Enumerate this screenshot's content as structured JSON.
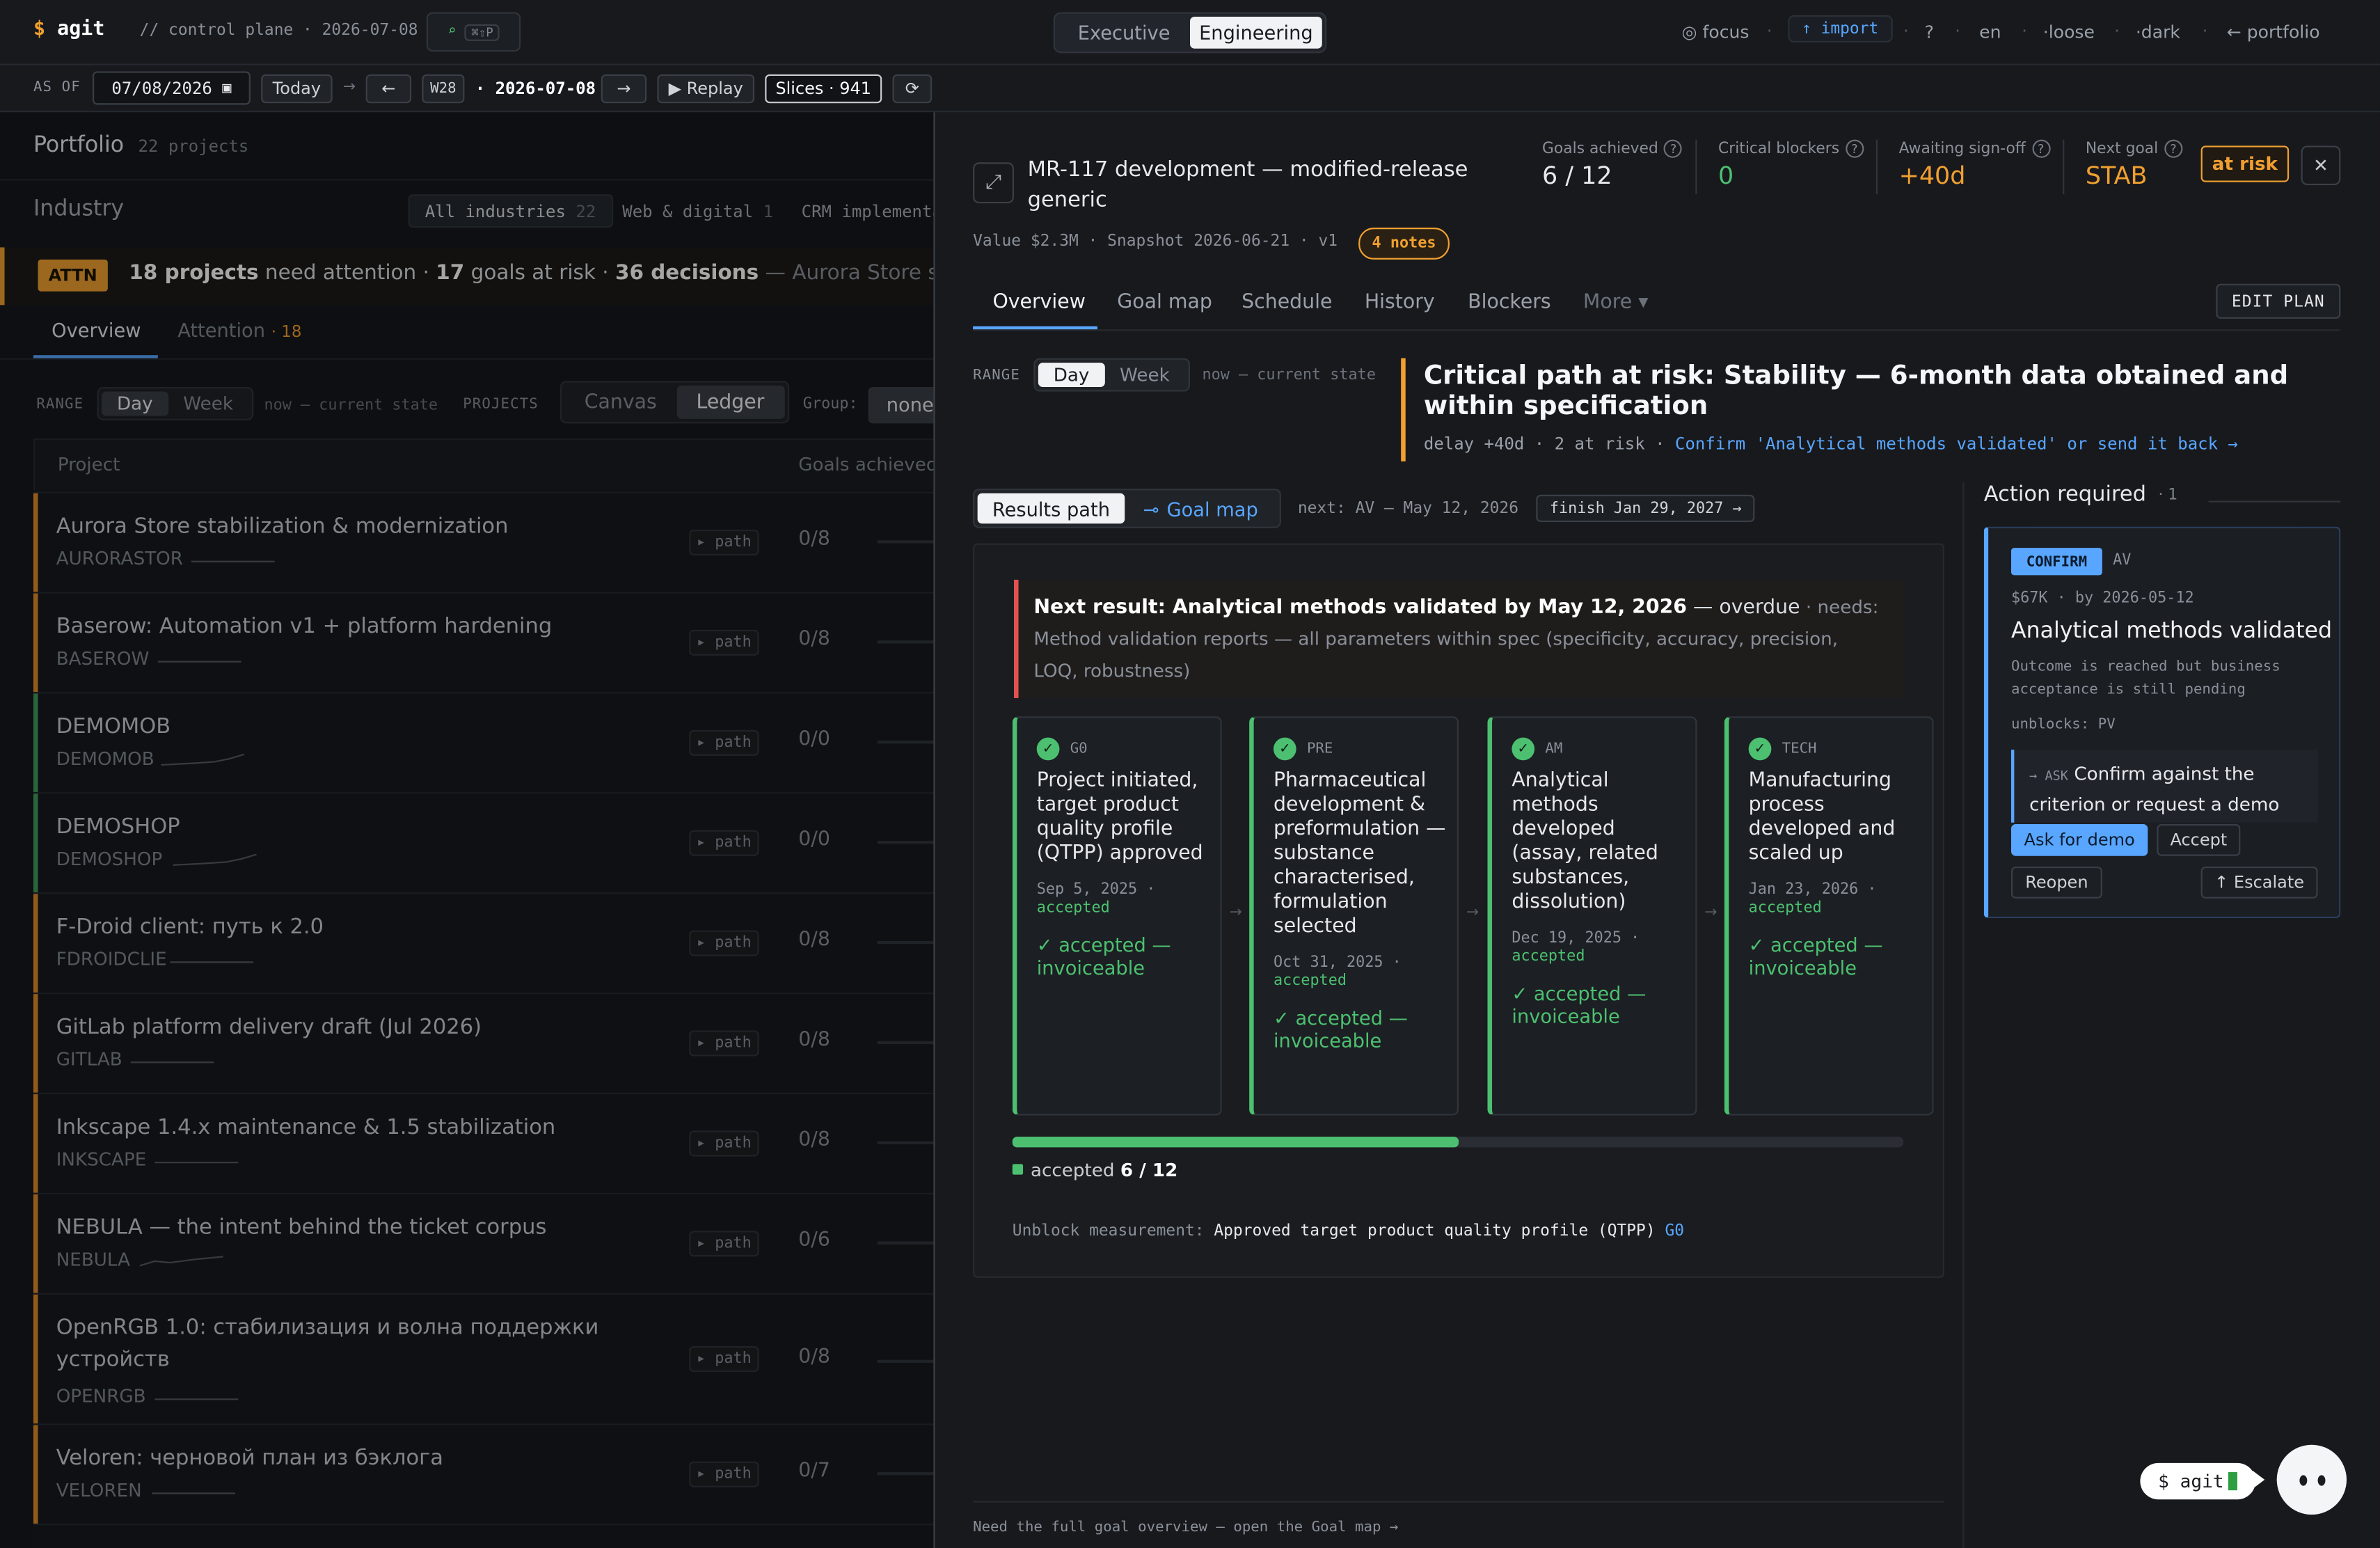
{
  "top": {
    "brand_symbol": "$",
    "brand": "agit",
    "crumb": "// control plane · 2026-07-08",
    "search_icon": "⌕",
    "search_kbd": "⌘⇧P",
    "modes": [
      "Executive",
      "Engineering"
    ],
    "focus": "◎ focus",
    "import": "↑ import",
    "help": "?",
    "lang": "en",
    "density": "·loose",
    "theme": "·dark",
    "portfolio": "← portfolio"
  },
  "timebar": {
    "asof": "AS OF",
    "date": "07/08/2026",
    "today": "Today",
    "arrow": "→",
    "prev": "←",
    "week": "W28",
    "current": "· 2026-07-08",
    "next": "→",
    "replay": "▶ Replay",
    "slices": "Slices · 941",
    "refresh": "⟳"
  },
  "portfolio": {
    "title": "Portfolio",
    "count": "22 projects",
    "industry": "Industry",
    "chips": [
      {
        "label": "All industries",
        "n": "22"
      },
      {
        "label": "Web & digital",
        "n": "1"
      },
      {
        "label": "CRM implementa",
        "n": ""
      }
    ],
    "attn": {
      "badge": "ATTN",
      "n1": "18 projects",
      "t1": " need attention · ",
      "n2": "17",
      "t2": " goals at risk · ",
      "n3": "36 decisions",
      "t3": " — Aurora Store stabilizati"
    },
    "tabs": {
      "overview": "Overview",
      "attention": "Attention",
      "attention_n": "· 18"
    },
    "range": "RANGE",
    "day": "Day",
    "week": "Week",
    "now": "now — current state",
    "projects": "PROJECTS",
    "canvas": "Canvas",
    "ledger": "Ledger",
    "group": "Group:",
    "group_val": "none",
    "col_project": "Project",
    "col_goals": "Goals achieved",
    "rows": [
      {
        "name": "Aurora Store stabilization & modernization",
        "code": "AURORASTOR",
        "goals": "0/8",
        "status": "#e08a2a"
      },
      {
        "name": "Baserow: Automation v1 + platform hardening",
        "code": "BASEROW",
        "goals": "0/8",
        "status": "#e08a2a"
      },
      {
        "name": "DEMOMOB",
        "code": "DEMOMOB",
        "goals": "0/0",
        "status": "#3f9a5a"
      },
      {
        "name": "DEMOSHOP",
        "code": "DEMOSHOP",
        "goals": "0/0",
        "status": "#3f9a5a"
      },
      {
        "name": "F-Droid client: путь к 2.0",
        "code": "FDROIDCLIE",
        "goals": "0/8",
        "status": "#e08a2a"
      },
      {
        "name": "GitLab platform delivery draft (Jul 2026)",
        "code": "GITLAB",
        "goals": "0/8",
        "status": "#e08a2a"
      },
      {
        "name": "Inkscape 1.4.x maintenance & 1.5 stabilization",
        "code": "INKSCAPE",
        "goals": "0/8",
        "status": "#e08a2a"
      },
      {
        "name": "NEBULA — the intent behind the ticket corpus",
        "code": "NEBULA",
        "goals": "0/6",
        "status": "#e08a2a"
      },
      {
        "name": "OpenRGB 1.0: стабилизация и волна поддержки устройств",
        "code": "OPENRGB",
        "goals": "0/8",
        "status": "#e08a2a"
      },
      {
        "name": "Veloren: черновой план из бэклога",
        "code": "VELOREN",
        "goals": "0/7",
        "status": "#e08a2a"
      }
    ],
    "path": "▸ path"
  },
  "detail": {
    "expand_icon": "⤢",
    "title": "MR-117 development — modified-release generic",
    "meta": "Value $2.3M · Snapshot 2026-06-21 · v1",
    "notes": "4 notes",
    "kpis": [
      {
        "label": "Goals achieved",
        "value": "6 / 12",
        "color": "#e6e8eb"
      },
      {
        "label": "Critical blockers",
        "value": "0",
        "color": "#4cc070"
      },
      {
        "label": "Awaiting sign-off",
        "value": "+40d",
        "color": "#f0a030"
      },
      {
        "label": "Next goal",
        "value": "STAB",
        "color": "#f0a030"
      }
    ],
    "risk": "at risk",
    "close": "✕",
    "tabs": [
      "Overview",
      "Goal map",
      "Schedule",
      "History",
      "Blockers",
      "More ▾"
    ],
    "edit": "EDIT PLAN",
    "range": "RANGE",
    "day": "Day",
    "week": "Week",
    "now": "now — current state",
    "crit_title": "Critical path at risk: Stability — 6-month data obtained and within specification",
    "crit_sub": "delay +40d · 2 at risk · ",
    "crit_link": "Confirm 'Analytical methods validated' or send it back →",
    "results_path": "Results path",
    "goal_map": "Goal map",
    "goal_map_icon": "⊸",
    "next": "next: AV — May 12, 2026",
    "finish": "finish Jan 29, 2027 →",
    "next_result": "Next result: Analytical methods validated by May 12, 2026",
    "overdue": " — overdue",
    "needs": " · needs:",
    "needs_text": "Method validation reports — all parameters within spec (specificity, accuracy, precision, LOQ, robustness)",
    "steps": [
      {
        "code": "G0",
        "title": "Project initiated, target product quality profile (QTPP) approved",
        "date": "Sep 5, 2025 ·",
        "acc": "accepted",
        "ok": "✓ accepted — invoiceable"
      },
      {
        "code": "PRE",
        "title": "Pharmaceutical development & preformulation — substance characterised, formulation selected",
        "date": "Oct 31, 2025 ·",
        "acc": "accepted",
        "ok": "✓ accepted — invoiceable"
      },
      {
        "code": "AM",
        "title": "Analytical methods developed (assay, related substances, dissolution)",
        "date": "Dec 19, 2025 ·",
        "acc": "accepted",
        "ok": "✓ accepted — invoiceable"
      },
      {
        "code": "TECH",
        "title": "Manufacturing process developed and scaled up",
        "date": "Jan 23, 2026 ·",
        "acc": "accepted",
        "ok": "✓ accepted — invoiceable"
      }
    ],
    "step_arrow": "→",
    "progress": 0.5,
    "accepted_label": "accepted",
    "accepted_val": "6 / 12",
    "unblock_label": "Unblock measurement:",
    "unblock_val": "Approved target product quality profile (QTPP)",
    "unblock_code": "G0",
    "footer": "Need the full goal overview — open the Goal map →"
  },
  "action": {
    "title": "Action required",
    "count": "· 1",
    "badge": "CONFIRM",
    "code": "AV",
    "meta": "$67K · by 2026-05-12",
    "name": "Analytical methods validated",
    "desc": "Outcome is reached but business acceptance is still pending",
    "unblocks": "unblocks: PV",
    "ask_tag": "→ ASK",
    "ask": "Confirm against the criterion or request a demo",
    "ask_demo": "Ask for demo",
    "accept": "Accept",
    "reopen": "Reopen",
    "escalate": "↑ Escalate"
  },
  "agent": {
    "prompt": "$ agit"
  },
  "colors": {
    "accent": "#58a6ff",
    "warn": "#f0a030",
    "ok": "#4cc070",
    "danger": "#e05252"
  }
}
